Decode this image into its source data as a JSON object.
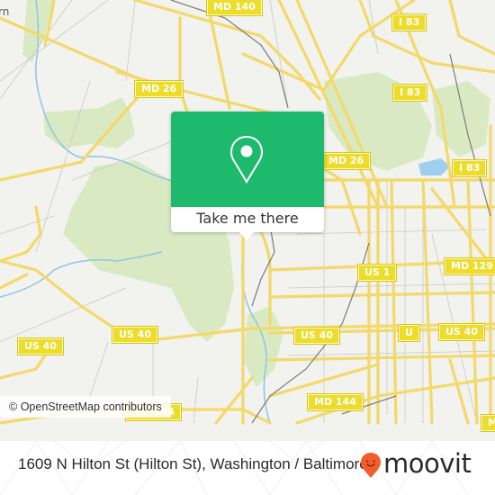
{
  "map": {
    "road_shields": [
      {
        "label": "MD 140"
      },
      {
        "label": "I 83"
      },
      {
        "label": "MD 26"
      },
      {
        "label": "I 83"
      },
      {
        "label": "MD 26"
      },
      {
        "label": "I 83"
      },
      {
        "label": "MD 129"
      },
      {
        "label": "US 1"
      },
      {
        "label": "US 40"
      },
      {
        "label": "US 40"
      },
      {
        "label": "US 40"
      },
      {
        "label": "US 40"
      },
      {
        "label": "MD 144"
      },
      {
        "label": "MD 144"
      },
      {
        "label": "U"
      },
      {
        "label": "M"
      }
    ],
    "edge_label": "rn",
    "attribution": {
      "prefix": "©",
      "link_text": "OpenStreetMap",
      "suffix": "contributors"
    },
    "colors": {
      "background": "#f2f2ee",
      "park": "#d4e8b8",
      "road": "#f5e37a",
      "water": "#8cc4e8",
      "rail": "#777777",
      "shield": "#eddc2a"
    }
  },
  "popup": {
    "icon": "map-pin-icon",
    "button_label": "Take me there",
    "accent_color": "#1db96c"
  },
  "footer": {
    "address": "1609 N Hilton St (Hilton St), Washington / Baltimore",
    "brand": "moovit",
    "brand_icon": "moovit-pin-logo-icon",
    "brand_color": "#f25d2a"
  }
}
